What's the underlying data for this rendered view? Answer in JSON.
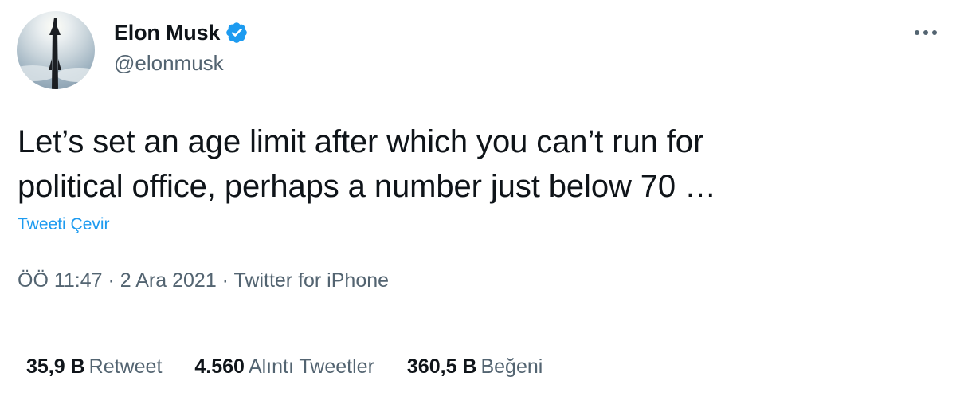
{
  "author": {
    "display_name": "Elon Musk",
    "handle": "@elonmusk",
    "verified": true,
    "verified_color": "#1d9bf0"
  },
  "tweet": {
    "text_line1": "Let’s set an age limit after which you can’t run for",
    "text_line2": "political office, perhaps a number just below 70 …",
    "translate_label": "Tweeti Çevir"
  },
  "meta": {
    "time": "ÖÖ 11:47",
    "separator": "·",
    "date": "2 Ara 2021",
    "source": "Twitter for iPhone"
  },
  "stats": [
    {
      "value": "35,9 B",
      "label": "Retweet"
    },
    {
      "value": "4.560",
      "label": "Alıntı Tweetler"
    },
    {
      "value": "360,5 B",
      "label": "Beğeni"
    }
  ],
  "icons": {
    "more": "more-horizontal-icon",
    "verified": "verified-badge-icon"
  },
  "colors": {
    "text_primary": "#0f1419",
    "text_secondary": "#536471",
    "link": "#1d9bf0",
    "divider": "#eff3f4"
  }
}
